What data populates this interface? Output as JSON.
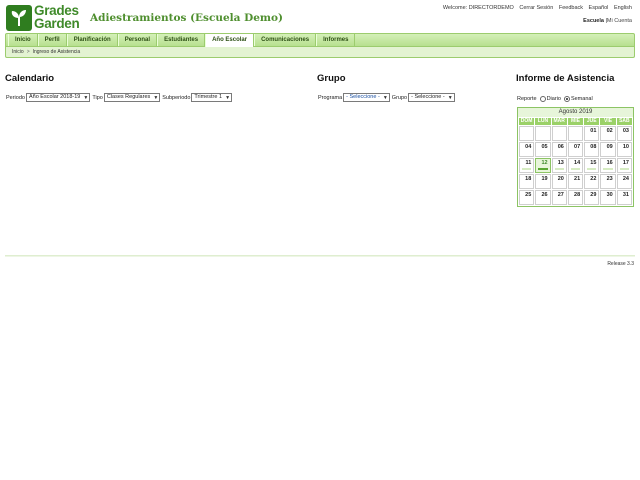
{
  "brand": {
    "line1": "Grades",
    "line2": "Garden"
  },
  "school_title": "Adiestramientos (Escuela Demo)",
  "top_links": {
    "welcome": "Welcome: DIRECTORDEMO",
    "items": [
      "Cerrar Sesión",
      "Feedback",
      "Español",
      "English"
    ]
  },
  "school_links": {
    "current": "Escuela",
    "sep": "|",
    "other": "Mi Cuenta"
  },
  "nav": {
    "items": [
      "Inicio",
      "Perfil",
      "Planificación",
      "Personal",
      "Estudiantes",
      "Año Escolar",
      "Comunicaciones",
      "Informes"
    ],
    "active_index": 5
  },
  "breadcrumb": {
    "home": "Inicio",
    "sep": ">",
    "current": "Ingreso de Asistencia"
  },
  "calendario": {
    "title": "Calendario",
    "periodo_label": "Periodo",
    "periodo_value": "Año Escolar 2018-19",
    "tipo_label": "Tipo",
    "tipo_value": "Clases Regulares",
    "subperiodo_label": "Subperiodo",
    "subperiodo_value": "Trimestre 1"
  },
  "grupo": {
    "title": "Grupo",
    "programa_label": "Programa",
    "programa_value": "- Seleccione -",
    "grupo_label": "Grupo",
    "grupo_value": "- Seleccione -"
  },
  "informe": {
    "title": "Informe de Asistencia",
    "reporte_label": "Reporte",
    "option_diario": "Diario",
    "option_semanal": "Semanal",
    "selected": "Semanal"
  },
  "calendar": {
    "month_label": "Agosto 2019",
    "dow": [
      "DOM",
      "LUN",
      "MAR",
      "MIÉ",
      "JUE",
      "VIE",
      "SÁB"
    ],
    "leading_blanks": 4,
    "days": [
      "01",
      "02",
      "03",
      "04",
      "05",
      "06",
      "07",
      "08",
      "09",
      "10",
      "11",
      "12",
      "13",
      "14",
      "15",
      "16",
      "17",
      "18",
      "19",
      "20",
      "21",
      "22",
      "23",
      "24",
      "25",
      "26",
      "27",
      "28",
      "29",
      "30",
      "31"
    ],
    "today": "12",
    "marked_days": [
      "11",
      "12",
      "13",
      "14",
      "15",
      "16",
      "17"
    ]
  },
  "colors": {
    "brand_green": "#3f8a2a",
    "nav_bg": "#b7e08f",
    "dow_bg": "#9bd168"
  },
  "release": "Release 3.3"
}
